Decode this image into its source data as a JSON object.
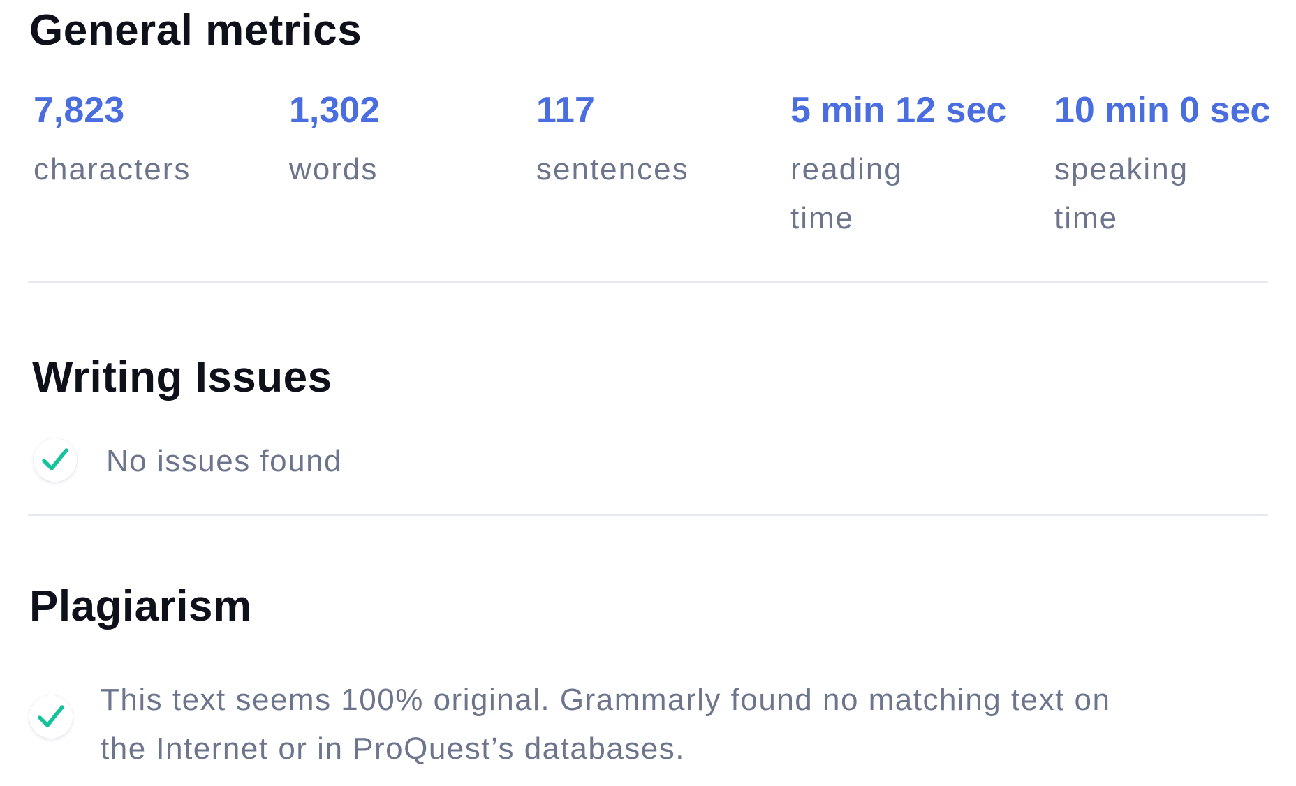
{
  "metrics": {
    "title": "General metrics",
    "items": [
      {
        "value": "7,823",
        "label": "characters"
      },
      {
        "value": "1,302",
        "label": "words"
      },
      {
        "value": "117",
        "label": "sentences"
      },
      {
        "value": "5 min 12 sec",
        "label": "reading time"
      },
      {
        "value": "10 min 0 sec",
        "label": "speaking time"
      }
    ]
  },
  "writing_issues": {
    "title": "Writing Issues",
    "status_text": "No issues found"
  },
  "plagiarism": {
    "title": "Plagiarism",
    "status_text": "This text seems 100% original. Grammarly found no matching text on the Internet or in ProQuest’s databases."
  },
  "colors": {
    "accent": "#4a6ee0",
    "success": "#15c39a",
    "muted_text": "#6d758d",
    "divider": "#e7e9f1"
  },
  "icons": {
    "check": "checkmark-icon"
  }
}
